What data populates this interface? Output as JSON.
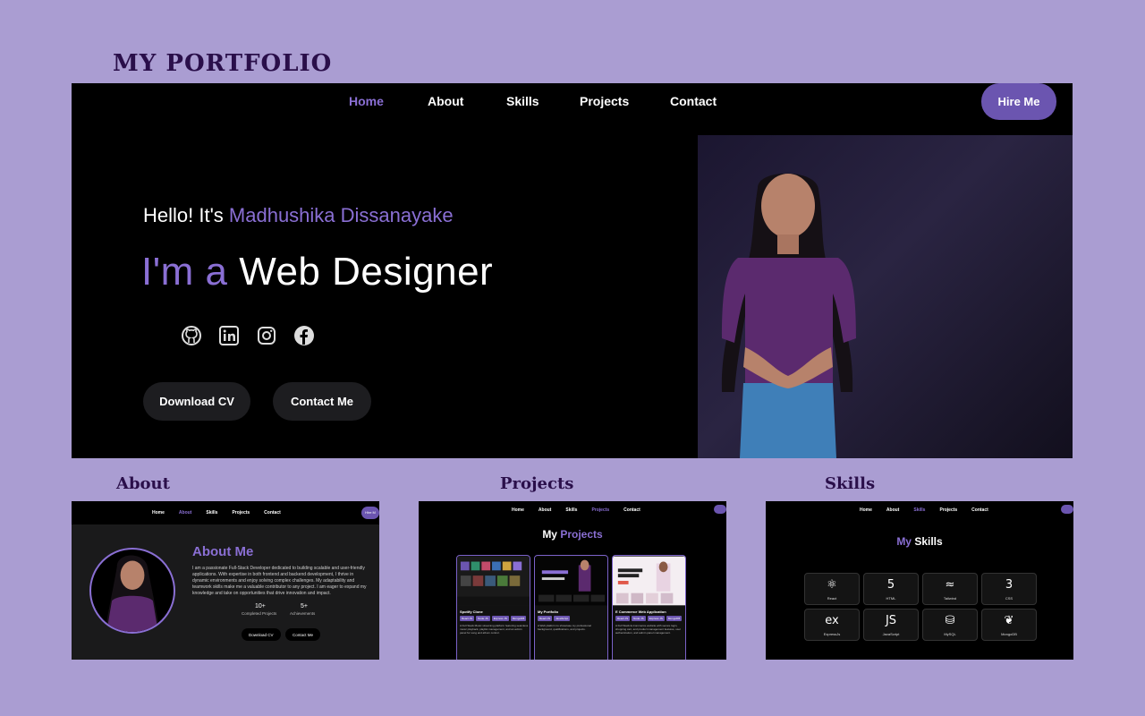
{
  "page": {
    "title": "MY PORTFOLIO"
  },
  "hero": {
    "nav": [
      {
        "label": "Home",
        "active": true
      },
      {
        "label": "About",
        "active": false
      },
      {
        "label": "Skills",
        "active": false
      },
      {
        "label": "Projects",
        "active": false
      },
      {
        "label": "Contact",
        "active": false
      }
    ],
    "hire_label": "Hire Me",
    "greeting": "Hello! It's ",
    "name": "Madhushika Dissanayake",
    "headline_prefix": "I'm a ",
    "headline_role": "Web Designer",
    "socials": [
      "github-icon",
      "linkedin-icon",
      "instagram-icon",
      "facebook-icon"
    ],
    "download_cv": "Download CV",
    "contact_me": "Contact Me"
  },
  "labels": {
    "about": "About",
    "projects": "Projects",
    "skills": "Skills"
  },
  "about_panel": {
    "nav": [
      "Home",
      "About",
      "Skills",
      "Projects",
      "Contact"
    ],
    "hire": "Hire M",
    "title": "About Me",
    "text": "I am a passionate Full-Stack Developer dedicated to building scalable and user-friendly applications. With expertise in both frontend and backend development, I thrive in dynamic environments and enjoy solving complex challenges. My adaptability and teamwork skills make me a valuable contributor to any project. I am eager to expand my knowledge and take on opportunities that drive innovation and impact.",
    "stat1_num": "10+",
    "stat1_label": "Completed Projects",
    "stat2_num": "5+",
    "stat2_label": "Achievements",
    "btn1": "Download CV",
    "btn2": "Contact Me"
  },
  "projects_panel": {
    "nav": [
      "Home",
      "About",
      "Skills",
      "Projects",
      "Contact"
    ],
    "heading_a": "My ",
    "heading_b": "Projects",
    "cards": [
      {
        "title": "Spotify Clone",
        "tags": [
          "React JS",
          "Node JS",
          "Express JS",
          "MongoDB"
        ],
        "desc": "A Full Stack Music streaming platform featuring seamless music playback, playlist management, and an admin panel for song and album control."
      },
      {
        "title": "My Portfolio",
        "tags": [
          "React JS",
          "JavaScript"
        ],
        "desc": "A Web platform to showcase my professional background, qualifications, and projects."
      },
      {
        "title": "E Commerce Web Application",
        "tags": [
          "React JS",
          "Node JS",
          "Express JS",
          "MongoDB"
        ],
        "desc": "A Full Stack E-Commerce website with secure login, shopping cart, and product management features, user authentication, and admin panel management."
      }
    ]
  },
  "skills_panel": {
    "nav": [
      "Home",
      "About",
      "Skills",
      "Projects",
      "Contact"
    ],
    "heading_a": "My ",
    "heading_b": "Skills",
    "skills": [
      {
        "name": "React",
        "icon": "⚛"
      },
      {
        "name": "HTML",
        "icon": "5"
      },
      {
        "name": "Tailwind",
        "icon": "≈"
      },
      {
        "name": "CSS",
        "icon": "3"
      },
      {
        "name": "ExpressJs",
        "icon": "ex"
      },
      {
        "name": "JavaScript",
        "icon": "JS"
      },
      {
        "name": "MySQL",
        "icon": "⛁"
      },
      {
        "name": "MongoDB",
        "icon": "❦"
      }
    ]
  },
  "colors": {
    "accent": "#8a6fd4",
    "page_bg": "#aa9dd2",
    "title": "#2a0f4a"
  }
}
